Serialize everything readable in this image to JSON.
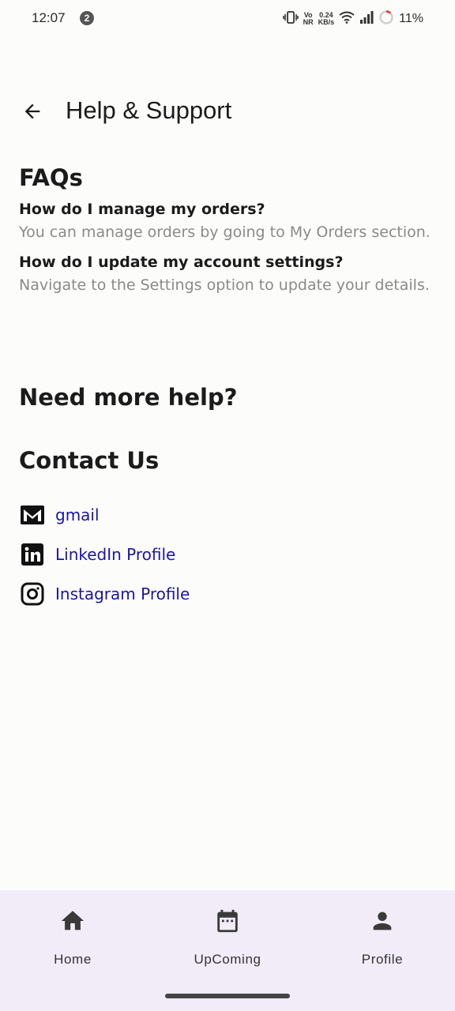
{
  "status_bar": {
    "time": "12:07",
    "notification_count": "2",
    "net_vo": "Vo",
    "net_nr": "NR",
    "speed_value": "0.24",
    "speed_unit": "KB/s",
    "battery": "11%"
  },
  "app_bar": {
    "back_icon": "arrow-back-icon",
    "title": "Help & Support"
  },
  "faqs": {
    "title": "FAQs",
    "items": [
      {
        "question": "How do I manage my orders?",
        "answer": "You can manage orders by going to My Orders section."
      },
      {
        "question": "How do I update my account settings?",
        "answer": "Navigate to the Settings option to update your details."
      }
    ]
  },
  "need_help": "Need more help?",
  "contact": {
    "title": "Contact Us",
    "link_color": "#1a14a8",
    "items": [
      {
        "icon": "gmail-icon",
        "label": "gmail"
      },
      {
        "icon": "linkedin-icon",
        "label": "LinkedIn Profile"
      },
      {
        "icon": "instagram-icon",
        "label": "Instagram Profile"
      }
    ]
  },
  "bottom_nav": {
    "background": "#f1ecf7",
    "items": [
      {
        "icon": "home-icon",
        "label": "Home"
      },
      {
        "icon": "calendar-icon",
        "label": "UpComing"
      },
      {
        "icon": "person-icon",
        "label": "Profile"
      }
    ]
  }
}
